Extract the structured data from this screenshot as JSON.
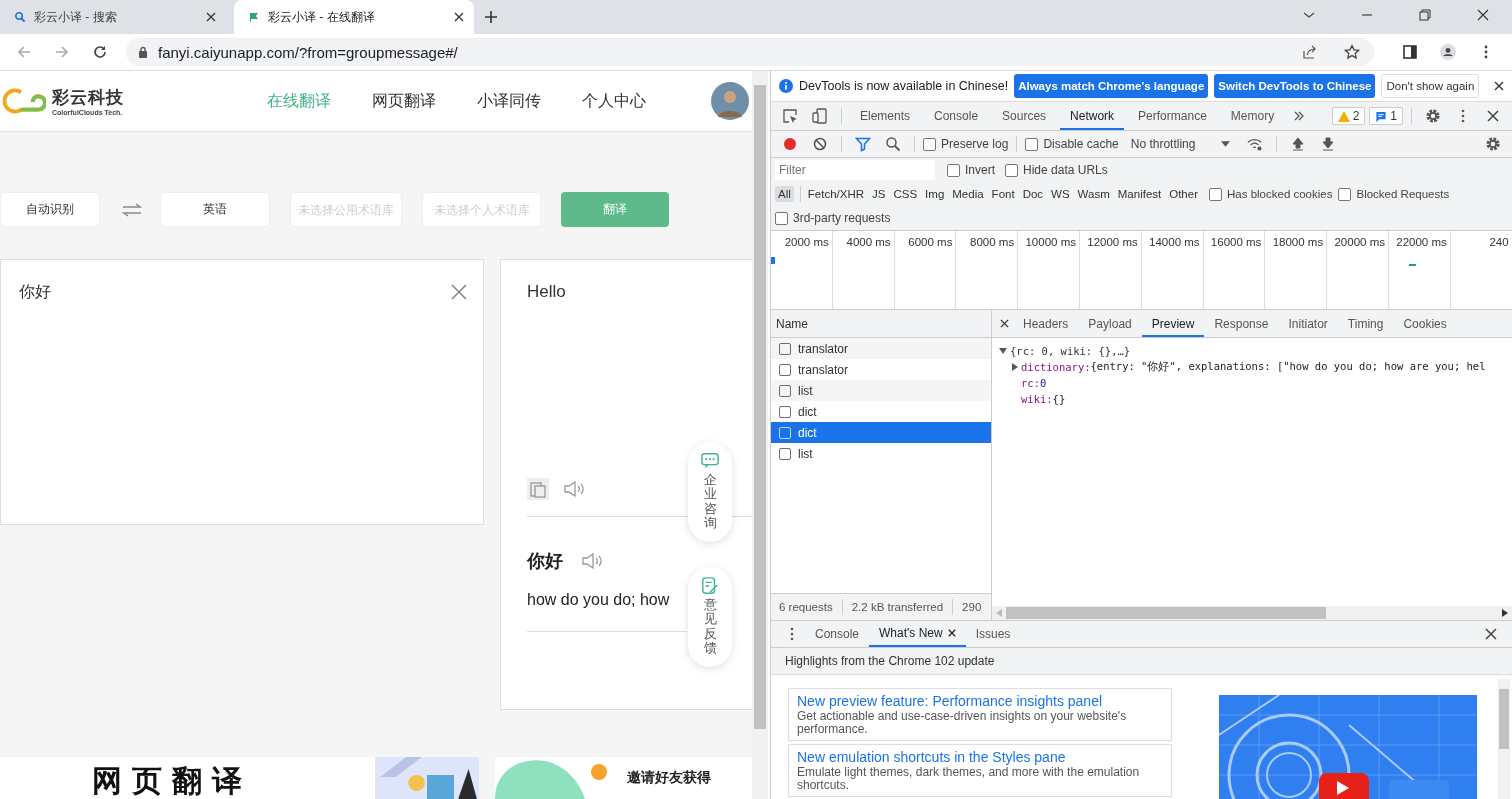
{
  "browser": {
    "tabs": [
      {
        "title": "彩云小译 - 搜索",
        "selected": false,
        "kind": "search"
      },
      {
        "title": "彩云小译 - 在线翻译",
        "selected": true,
        "kind": "flag"
      }
    ],
    "url": "fanyi.caiyunapp.com/?from=groupmessage#/"
  },
  "page": {
    "logo": {
      "name": "彩云科技",
      "tagline": "ColorfulClouds Tech."
    },
    "nav": [
      {
        "label": "在线翻译",
        "selected": true
      },
      {
        "label": "网页翻译",
        "selected": false
      },
      {
        "label": "小译同传",
        "selected": false
      },
      {
        "label": "个人中心",
        "selected": false
      }
    ],
    "controls": {
      "source_lang": "自动识别",
      "target_lang": "英语",
      "public_glossary": {
        "placeholder": "未选择公用术语库"
      },
      "personal_glossary": {
        "placeholder": "未选择个人术语库"
      },
      "translate": "翻译"
    },
    "source": {
      "value": "你好"
    },
    "target": {
      "text": "Hello"
    },
    "dictionary": {
      "entry": "你好",
      "explanation": "how do you do; how"
    },
    "floats": [
      {
        "label": "企业咨询",
        "kind": "chat"
      },
      {
        "label": "意见反馈",
        "kind": "edit"
      }
    ],
    "banners": [
      {
        "text": "网页翻译"
      },
      {
        "text": "邀请好友获得"
      }
    ]
  },
  "devtools": {
    "infobar": {
      "message": "DevTools is now available in Chinese!",
      "buttons": [
        {
          "label": "Always match Chrome's language",
          "kind": "primary"
        },
        {
          "label": "Switch DevTools to Chinese",
          "kind": "primary"
        },
        {
          "label": "Don't show again",
          "kind": "plain"
        }
      ]
    },
    "panels": [
      {
        "label": "Elements",
        "selected": false
      },
      {
        "label": "Console",
        "selected": false
      },
      {
        "label": "Sources",
        "selected": false
      },
      {
        "label": "Network",
        "selected": true
      },
      {
        "label": "Performance",
        "selected": false
      },
      {
        "label": "Memory",
        "selected": false
      }
    ],
    "warnings": "2",
    "messages": "1",
    "toolbar": {
      "recording": true,
      "checkboxes": [
        {
          "label": "Preserve log",
          "checked": false
        },
        {
          "label": "Disable cache",
          "checked": false
        }
      ],
      "throttling": "No throttling"
    },
    "filter": {
      "placeholder": "Filter",
      "checkboxes": [
        {
          "label": "Invert",
          "checked": false
        },
        {
          "label": "Hide data URLs",
          "checked": false
        }
      ]
    },
    "types": [
      {
        "label": "All",
        "selected": true
      },
      {
        "label": "Fetch/XHR",
        "selected": false
      },
      {
        "label": "JS",
        "selected": false
      },
      {
        "label": "CSS",
        "selected": false
      },
      {
        "label": "Img",
        "selected": false
      },
      {
        "label": "Media",
        "selected": false
      },
      {
        "label": "Font",
        "selected": false
      },
      {
        "label": "Doc",
        "selected": false
      },
      {
        "label": "WS",
        "selected": false
      },
      {
        "label": "Wasm",
        "selected": false
      },
      {
        "label": "Manifest",
        "selected": false
      },
      {
        "label": "Other",
        "selected": false
      }
    ],
    "options": [
      {
        "label": "Has blocked cookies",
        "checked": false
      },
      {
        "label": "Blocked Requests",
        "checked": false
      },
      {
        "label": "3rd-party requests",
        "checked": false
      }
    ],
    "timeline": {
      "ticks": [
        "2000 ms",
        "4000 ms",
        "6000 ms",
        "8000 ms",
        "10000 ms",
        "12000 ms",
        "14000 ms",
        "16000 ms",
        "18000 ms",
        "20000 ms",
        "22000 ms",
        "240"
      ]
    },
    "requests": {
      "header": "Name",
      "rows": [
        {
          "name": "translator",
          "selected": false
        },
        {
          "name": "translator",
          "selected": false
        },
        {
          "name": "list",
          "selected": false
        },
        {
          "name": "dict",
          "selected": false
        },
        {
          "name": "dict",
          "selected": true
        },
        {
          "name": "list",
          "selected": false
        }
      ],
      "summary": [
        "6 requests",
        "2.2 kB transferred",
        "290"
      ]
    },
    "detail_tabs": [
      {
        "label": "Headers",
        "selected": false
      },
      {
        "label": "Payload",
        "selected": false
      },
      {
        "label": "Preview",
        "selected": true
      },
      {
        "label": "Response",
        "selected": false
      },
      {
        "label": "Initiator",
        "selected": false
      },
      {
        "label": "Timing",
        "selected": false
      },
      {
        "label": "Cookies",
        "selected": false
      }
    ],
    "preview": {
      "summary": "{rc: 0, wiki: {},…}",
      "expanded": true,
      "children": [
        {
          "key": "dictionary:",
          "value": "{entry: \"你好\", explanations: [\"how do you do; how are you; hel",
          "kind": "object"
        },
        {
          "key": "rc:",
          "value": "0",
          "kind": "number"
        },
        {
          "key": "wiki:",
          "value": "{}",
          "kind": "plain"
        }
      ]
    },
    "drawer": {
      "tabs": [
        {
          "label": "Console",
          "selected": false,
          "closable": false
        },
        {
          "label": "What's New",
          "selected": true,
          "closable": true
        },
        {
          "label": "Issues",
          "selected": false,
          "closable": false
        }
      ],
      "heading": "Highlights from the Chrome 102 update",
      "cards": [
        {
          "title": "New preview feature: Performance insights panel",
          "text": "Get actionable and use-case-driven insights on your website's performance."
        },
        {
          "title": "New emulation shortcuts in the Styles pane",
          "text": "Emulate light themes, dark themes, and more with the emulation shortcuts."
        }
      ]
    }
  }
}
